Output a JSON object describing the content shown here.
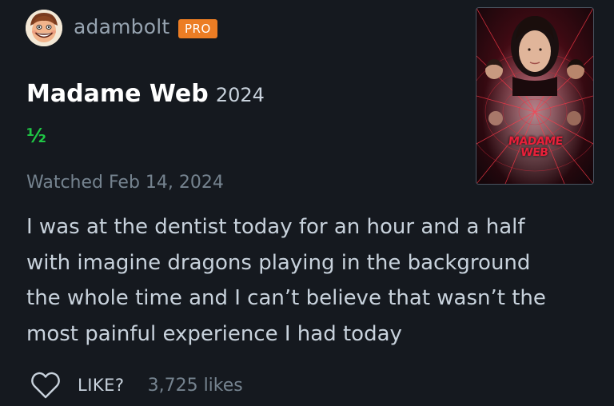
{
  "profile": {
    "username": "adambolt",
    "badge": "PRO",
    "avatar_icon": "cartoon-face-avatar-icon"
  },
  "film": {
    "title": "Madame Web",
    "year": "2024",
    "poster_title": "MADAME\nWEB"
  },
  "review": {
    "rating": "½",
    "watched": "Watched Feb 14, 2024",
    "text": "I was at the dentist today for an hour and a half\nwith imagine dragons playing in the background\nthe whole time and I can’t believe that wasn’t the\nmost painful experience I had today"
  },
  "actions": {
    "like_label": "LIKE?",
    "likes_count": "3,725 likes",
    "heart_icon": "heart-icon"
  },
  "colors": {
    "background": "#15191f",
    "badge": "#ec7d24",
    "rating": "#1fc645",
    "muted_text": "#75838f",
    "body_text": "#c8d2dc"
  }
}
